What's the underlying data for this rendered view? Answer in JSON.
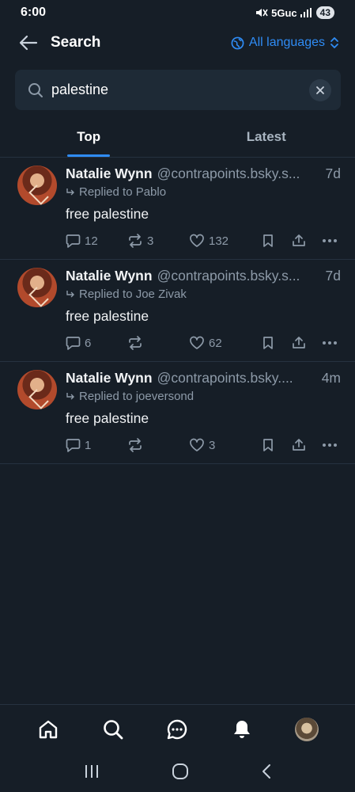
{
  "status_bar": {
    "time": "6:00",
    "network": "5Guc",
    "battery": "43"
  },
  "header": {
    "title": "Search",
    "language_label": "All languages"
  },
  "search": {
    "value": "palestine",
    "placeholder": ""
  },
  "tabs": [
    {
      "label": "Top",
      "active": true
    },
    {
      "label": "Latest",
      "active": false
    }
  ],
  "posts": [
    {
      "author": "Natalie Wynn",
      "handle": "@contrapoints.bsky.s...",
      "age": "7d",
      "replied_to": "Replied to Pablo",
      "text": "free palestine",
      "replies": "12",
      "reposts": "3",
      "likes": "132"
    },
    {
      "author": "Natalie Wynn",
      "handle": "@contrapoints.bsky.s...",
      "age": "7d",
      "replied_to": "Replied to Joe Zivak",
      "text": "free palestine",
      "replies": "6",
      "reposts": "",
      "likes": "62"
    },
    {
      "author": "Natalie Wynn",
      "handle": "@contrapoints.bsky....",
      "age": "4m",
      "replied_to": "Replied to joeversond",
      "text": "free palestine",
      "replies": "1",
      "reposts": "",
      "likes": "3"
    }
  ],
  "colors": {
    "background": "#161e27",
    "accent": "#2f8cf5",
    "muted_text": "#8d9aa8"
  }
}
